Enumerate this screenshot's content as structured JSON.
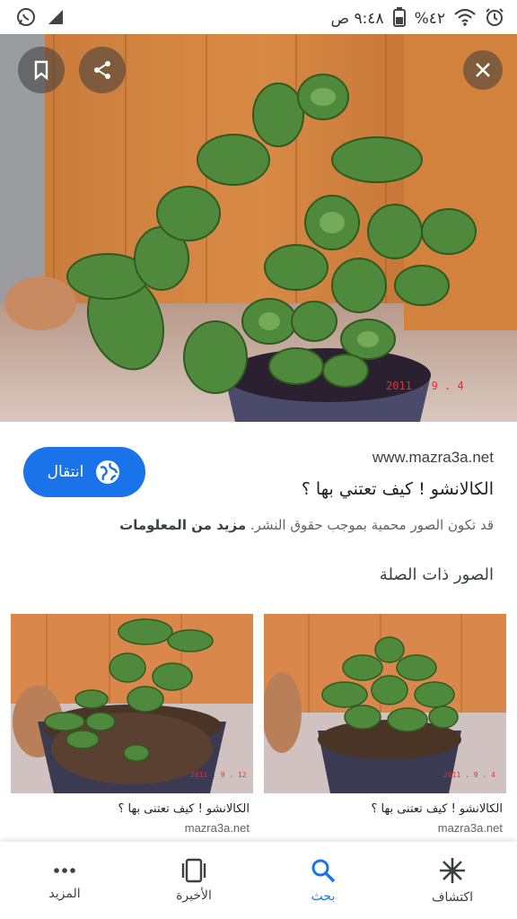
{
  "status_bar": {
    "time": "٩:٤٨ ص",
    "battery": "%٤٢"
  },
  "hero": {
    "watermark": "2011 . 9 . 4"
  },
  "info": {
    "visit_label": "انتقال",
    "source_url": "www.mazra3a.net",
    "title": "الكالانشو ! كيف تعتني بها ؟",
    "copyright_text": "قد تكون الصور محمية بموجب حقوق النشر.",
    "more_info_label": "مزيد من المعلومات",
    "related_heading": "الصور ذات الصلة"
  },
  "related": [
    {
      "title": "الكالانشو ! كيف تعتنى بها ؟",
      "source": "mazra3a.net",
      "watermark": "2011 . 9 . 12"
    },
    {
      "title": "الكالانشو ! كيف تعتنى بها ؟",
      "source": "mazra3a.net",
      "watermark": "2011 . 9 . 4"
    }
  ],
  "nav": {
    "discover": "اكتشاف",
    "search": "بحث",
    "recent": "الأخيرة",
    "more": "المزيد"
  },
  "colors": {
    "accent": "#1a73e8",
    "text_primary": "#202124",
    "text_secondary": "#5f6368"
  },
  "icons": [
    "whatsapp-icon",
    "signal-icon",
    "alarm-icon",
    "wifi-icon",
    "battery-icon",
    "bookmark-icon",
    "share-icon",
    "close-icon",
    "globe-icon",
    "asterisk-icon",
    "search-icon",
    "tabs-icon",
    "more-dots-icon"
  ]
}
